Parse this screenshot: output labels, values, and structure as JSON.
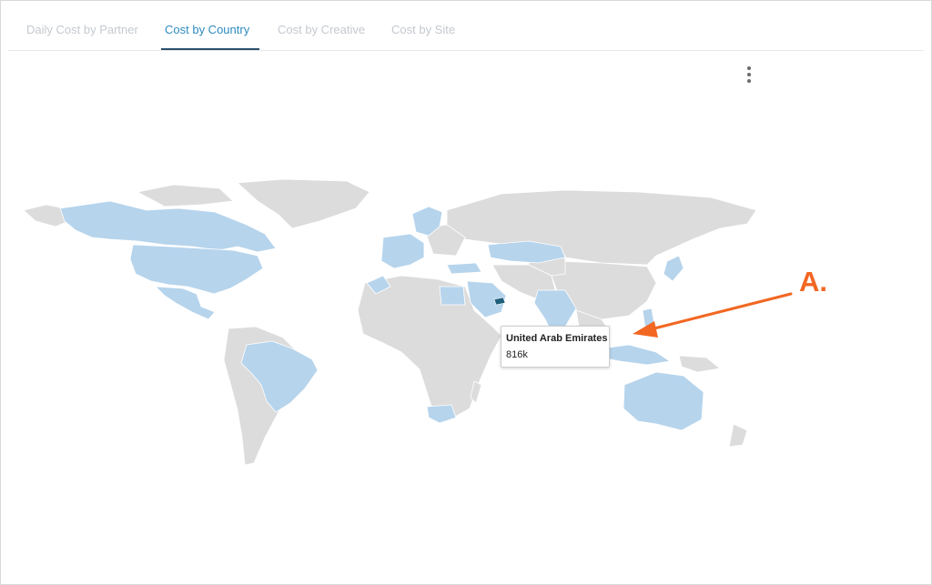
{
  "tabs": [
    {
      "label": "Daily Cost by Partner",
      "active": false
    },
    {
      "label": "Cost by Country",
      "active": true
    },
    {
      "label": "Cost by Creative",
      "active": false
    },
    {
      "label": "Cost by Site",
      "active": false
    }
  ],
  "menu": {
    "icon": "kebab-menu-icon"
  },
  "map": {
    "highlight_color": "#b6d4ec",
    "hover_color": "#1f5f7a",
    "default_color": "#dcdcdc",
    "highlighted_regions": [
      "Canada",
      "United States",
      "Mexico",
      "Brazil",
      "Sweden",
      "Finland",
      "Europe",
      "Egypt",
      "Saudi Arabia",
      "United Arab Emirates",
      "Kazakhstan",
      "India",
      "Japan",
      "Philippines",
      "Indonesia",
      "Australia",
      "South Africa"
    ]
  },
  "tooltip": {
    "country": "United Arab Emirates",
    "value": "816k"
  },
  "annotation": {
    "label": "A.",
    "color": "#f26722"
  }
}
